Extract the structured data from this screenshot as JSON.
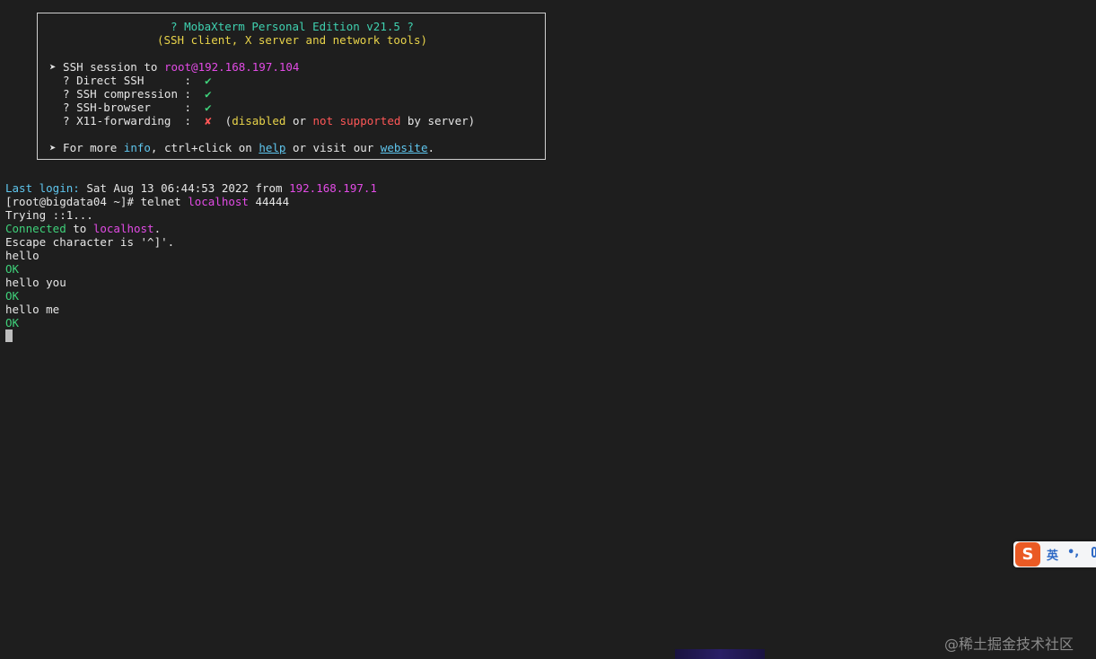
{
  "banner": {
    "title": "? MobaXterm Personal Edition v21.5 ?",
    "subtitle": "(SSH client, X server and network tools)",
    "session_prefix": "➤ SSH session to ",
    "session_target": "root@192.168.197.104",
    "features": [
      {
        "label": "  ? Direct SSH      :  ",
        "mark": "✔"
      },
      {
        "label": "  ? SSH compression :  ",
        "mark": "✔"
      },
      {
        "label": "  ? SSH-browser     :  ",
        "mark": "✔"
      },
      {
        "label": "  ? X11-forwarding  :  ",
        "mark": "✘"
      }
    ],
    "x11_note": {
      "open": "  (",
      "disabled": "disabled",
      "or": " or ",
      "not_supported": "not supported",
      "by_server": " by server)"
    },
    "more": {
      "prefix": "➤ For more ",
      "info": "info",
      "mid1": ", ctrl+click on ",
      "help": "help",
      "mid2": " or visit our ",
      "website": "website",
      "end": "."
    }
  },
  "session": {
    "last_login_label": "Last login:",
    "last_login_text": " Sat Aug 13 06:44:53 2022 from ",
    "last_login_ip": "192.168.197.1",
    "prompt": "[root@bigdata04 ~]# ",
    "cmd_telnet": "telnet ",
    "cmd_host": "localhost",
    "cmd_port": " 44444",
    "trying": "Trying ::1...",
    "connected_word": "Connected",
    "connected_to": " to ",
    "connected_host": "localhost",
    "connected_end": ".",
    "escape": "Escape character is '^]'.",
    "lines": [
      {
        "text": "hello",
        "response": "OK"
      },
      {
        "text": "hello you",
        "response": "OK"
      },
      {
        "text": "hello me",
        "response": "OK"
      }
    ]
  },
  "ime": {
    "logo": "S",
    "lang": "英",
    "punct": "•,"
  },
  "watermark": "@稀土掘金技术社区",
  "colors": {
    "background": "#1e1e1e",
    "green": "#3fd17a",
    "yellow": "#e8d34a",
    "magenta": "#e24be5",
    "cyan": "#5fc6ee",
    "red": "#ff5757"
  }
}
